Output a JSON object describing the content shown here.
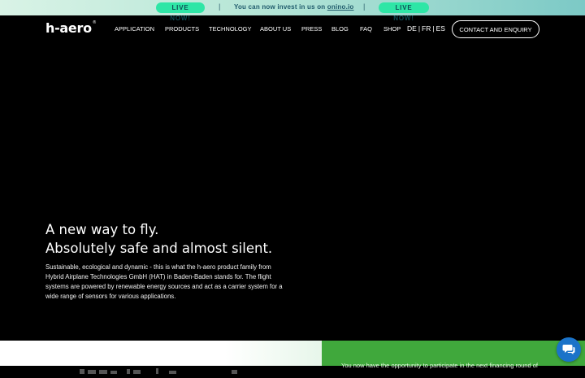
{
  "banner": {
    "live_left": "LIVE NOW!",
    "separator": "|",
    "text_prefix": "You can now invest in us on ",
    "link": "onino.io",
    "live_right": "LIVE NOW!"
  },
  "header": {
    "logo": "h-aero",
    "logo_mark": "®",
    "nav": [
      "APPLICATION",
      "PRODUCTS",
      "TECHNOLOGY",
      "ABOUT US",
      "PRESS",
      "BLOG",
      "FAQ",
      "SHOP"
    ],
    "languages": [
      "DE",
      "FR",
      "ES"
    ],
    "lang_separator": "|",
    "contact_label": "CONTACT AND ENQUIRY"
  },
  "hero": {
    "title_line1": "A new way to fly.",
    "title_line2": "Absolutely safe and almost silent.",
    "text": "Sustainable, ecological and dynamic - this is what the h-aero product family from Hybrid Airplane Technologies GmbH (HAT) in Baden-Baden stands for. The flight systems are powered by renewable energy sources and act as a carrier system for a wide range of sensors for various applications."
  },
  "bottom": {
    "right_text": "You now have the opportunity to participate in the next financing round of"
  },
  "colors": {
    "accent_green": "#40a83c",
    "pill_green": "#2ee6a6",
    "chat_blue": "#1a73c9"
  },
  "icons": {
    "chat": "chat-bubble-icon"
  }
}
